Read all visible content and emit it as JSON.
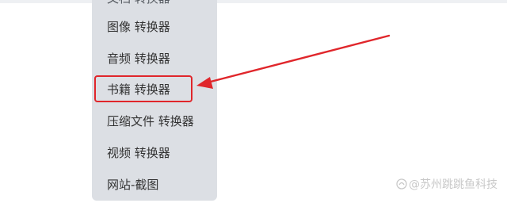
{
  "menu": {
    "items": [
      {
        "label": "文档 转换器"
      },
      {
        "label": "图像 转换器"
      },
      {
        "label": "音频 转换器"
      },
      {
        "label": "书籍 转换器"
      },
      {
        "label": "压缩文件 转换器"
      },
      {
        "label": "视频 转换器"
      },
      {
        "label": "网站-截图"
      }
    ]
  },
  "watermark": {
    "text": "@苏州跳跳鱼科技"
  },
  "colors": {
    "highlight": "#e0262b",
    "menu_background": "#dcdfe4",
    "menu_text": "#333333"
  }
}
